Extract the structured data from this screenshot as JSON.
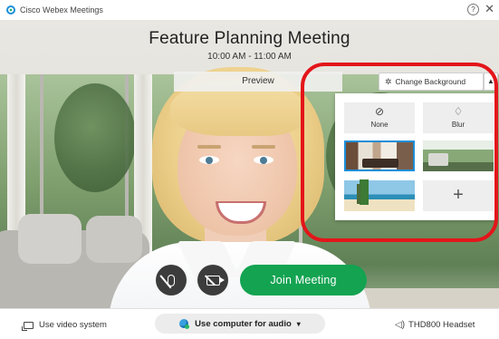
{
  "window": {
    "app_title": "Cisco Webex Meetings",
    "help_glyph": "?",
    "close_glyph": "✕"
  },
  "meeting": {
    "title": "Feature Planning Meeting",
    "time": "10:00 AM - 11:00 AM",
    "preview_label": "Preview"
  },
  "background_panel": {
    "button_label": "Change Background",
    "button_icon": "magic-wand-icon",
    "collapse_glyph": "▲",
    "tiles": {
      "none": {
        "label": "None",
        "icon": "none-icon",
        "glyph": "⊘"
      },
      "blur": {
        "label": "Blur",
        "icon": "blur-drop-icon",
        "glyph": "♢"
      },
      "add_glyph": "+"
    },
    "highlight_color": "#e3151a",
    "selected_border_color": "#1b8fd8"
  },
  "controls": {
    "mute_icon": "mic-off-icon",
    "video_icon": "video-off-icon",
    "join_label": "Join Meeting",
    "join_color": "#13a351"
  },
  "bottom_bar": {
    "video_system_label": "Use video system",
    "audio_label": "Use computer for audio",
    "audio_caret": "▾",
    "headset_label": "THD800 Headset",
    "speaker_glyph": "◁)"
  }
}
